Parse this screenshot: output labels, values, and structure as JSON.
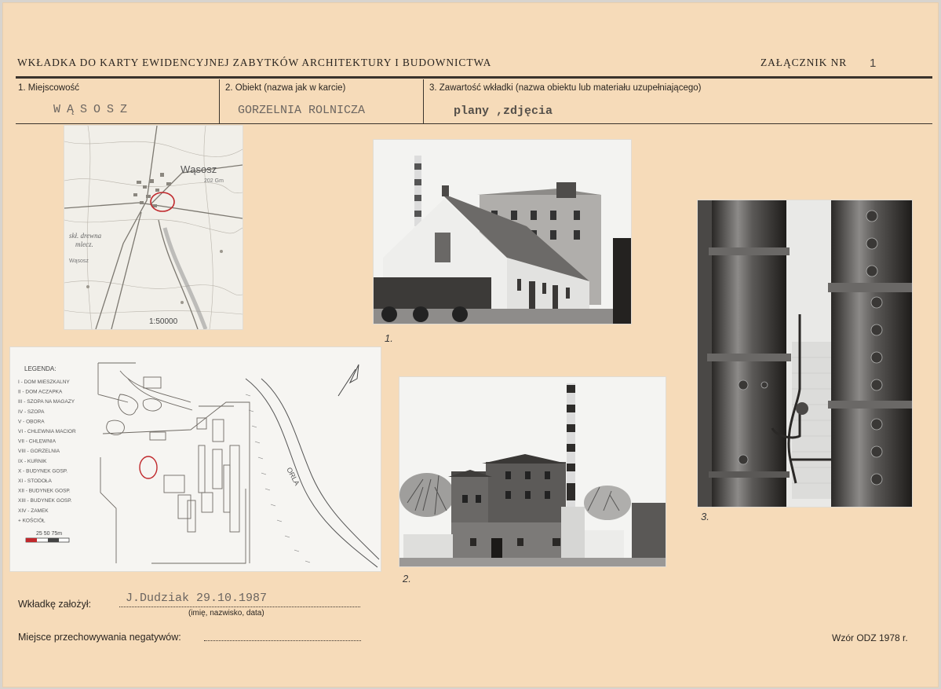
{
  "header": {
    "title": "WKŁADKA DO KARTY EWIDENCYJNEJ ZABYTKÓW  ARCHITEKTURY I BUDOWNICTWA",
    "attachment_label": "ZAŁĄCZNIK NR",
    "attachment_number": "1"
  },
  "fields": {
    "locality_label": "1.  Miejscowość",
    "locality_value": "WĄSOSZ",
    "object_label": "2.  Obiekt (nazwa jak w karcie)",
    "object_value": "GORZELNIA ROLNICZA",
    "content_label": "3.  Zawartość wkładki (nazwa obiektu lub materiału uzupełniającego)",
    "content_value": "plany ,zdjęcia"
  },
  "map": {
    "town": "Wąsosz",
    "elevation": "202 Gm",
    "label_mill": "skł. drewna",
    "label_dairy": "mlecz.",
    "label_town_small": "Wąsosz",
    "scale": "1:50000"
  },
  "plan": {
    "legend_title": "LEGENDA:",
    "legend_items": [
      "I - DOM MIESZKALNY",
      "II - DOM ACZAPKA",
      "III - SZOPA NA MAGAZY",
      "IV - SZOPA",
      "V - OBORA",
      "VI - CHLEWNIA MACIOR",
      "VII - CHLEWNIA",
      "VIII - GORZELNIA",
      "IX - KURNIK",
      "X - BUDYNEK GOSP.",
      "XI - STODOŁA",
      "XII - BUDYNEK GOSP.",
      "XIII - BUDYNEK GOSP.",
      "XIV - ZAMEK",
      "+ KOŚCIÓŁ"
    ],
    "scale_text": "25  50  75m",
    "river": "ORLA"
  },
  "photos": {
    "photo1_number": "1.",
    "photo2_number": "2.",
    "photo3_number": "3."
  },
  "footer": {
    "founded_label": "Wkładkę  założył:",
    "founded_value": "J.Dudziak 29.10.1987",
    "founded_caption": "(imię, nazwisko, data)",
    "negatives_label": "Miejsce przechowywania negatywów:",
    "form_code": "Wzór ODZ 1978 r."
  }
}
